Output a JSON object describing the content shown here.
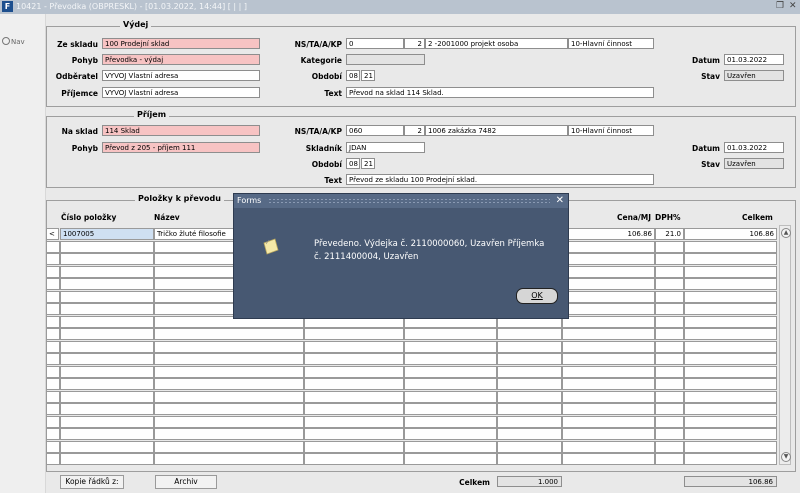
{
  "titlebar": {
    "app_icon": "F",
    "title": "10421 - Převodka (OBPRESKL) - [01.03.2022, 14:44]",
    "extra": "[ | | ]",
    "restore_icon": "restore-icon",
    "close_icon": "close-icon"
  },
  "nav": {
    "label": "Nav"
  },
  "vydej": {
    "title": "Výdej",
    "ze_skladu_label": "Ze skladu",
    "ze_skladu": "100 Prodejní sklad",
    "pohyb_label": "Pohyb",
    "pohyb": "Převodka - výdaj",
    "odberatel_label": "Odběratel",
    "odberatel": "VYVOJ Vlastní adresa",
    "prijemce_label": "Příjemce",
    "prijemce": "VYVOJ Vlastní adresa",
    "ns_label": "NS/TA/A/KP",
    "ns_1": "0",
    "ns_2": "2",
    "ns_3": "2 -2001000 projekt osoba",
    "ns_4": "10-Hlavní činnost",
    "kategorie_label": "Kategorie",
    "kategorie": "",
    "obdobi_label": "Období",
    "obdobi_1": "08",
    "obdobi_2": "21",
    "text_label": "Text",
    "text": "Převod na sklad 114 Sklad.",
    "datum_label": "Datum",
    "datum": "01.03.2022",
    "stav_label": "Stav",
    "stav": "Uzavřen"
  },
  "prijem": {
    "title": "Příjem",
    "na_sklad_label": "Na sklad",
    "na_sklad": "114 Sklad",
    "pohyb_label": "Pohyb",
    "pohyb": "Převod z 205 - příjem 111",
    "ns_label": "NS/TA/A/KP",
    "ns_1": "060",
    "ns_2": "2",
    "ns_3": "1006 zakázka 7482",
    "ns_4": "10-Hlavní činnost",
    "skladnik_label": "Skladník",
    "skladnik": "JDAN",
    "obdobi_label": "Období",
    "obdobi_1": "08",
    "obdobi_2": "21",
    "text_label": "Text",
    "text": "Převod ze skladu 100 Prodejní sklad.",
    "datum_label": "Datum",
    "datum": "01.03.2022",
    "stav_label": "Stav",
    "stav": "Uzavřen"
  },
  "polozky": {
    "title": "Položky k převodu",
    "col_cislo": "Číslo položky",
    "col_nazev": "Název",
    "col_cena": "Cena/MJ",
    "col_dph": "DPH%",
    "col_celkem": "Celkem",
    "row1": {
      "marker": "<",
      "cislo": "1007005",
      "nazev": "Tričko žluté filosofie",
      "cena": "106.86",
      "dph": "21.0",
      "celkem": "106.86"
    }
  },
  "footer": {
    "kopie": "Kopie řádků z:",
    "archiv": "Archiv",
    "celkem_label": "Celkem",
    "celkem_qty": "1.000",
    "celkem_sum": "106.86"
  },
  "dialog": {
    "title": "Forms",
    "message": "Převedeno. Výdejka č. 2110000060, Uzavřen Příjemka č. 2111400004, Uzavřen",
    "ok": "OK",
    "icon": "note-icon"
  }
}
